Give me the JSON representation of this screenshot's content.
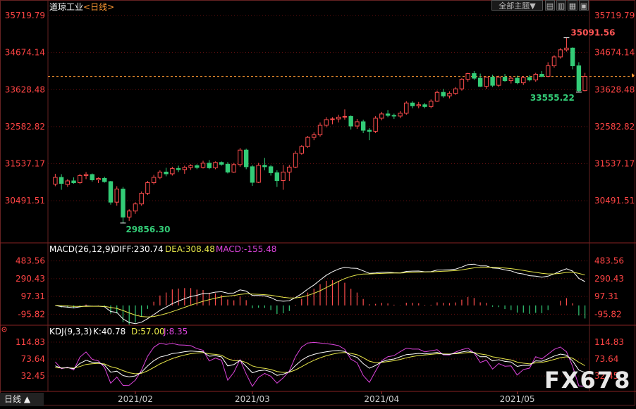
{
  "header": {
    "symbol": "道琼工业",
    "period": "<日线>",
    "theme_button": "全部主题▼",
    "period_tab": "日线 ▲"
  },
  "watermark": "FX678",
  "colors": {
    "up": "#ff4d4d",
    "down": "#33cc77",
    "axis_text": "#ff4444",
    "grid": "#661111",
    "price_line": "#ff9933",
    "diff": "#ffffff",
    "dea": "#e8e84a",
    "macd": "#dd44dd",
    "k": "#ffffff",
    "d": "#e8e84a",
    "j": "#dd44dd"
  },
  "chart_data": [
    {
      "type": "candlestick",
      "title": "道琼工业<日线>",
      "ylim": [
        29400,
        35800
      ],
      "y_ticks": [
        "35719.79",
        "34674.14",
        "33628.48",
        "32582.82",
        "31537.17",
        "30491.51"
      ],
      "x_ticks": [
        "2021/02",
        "2021/03",
        "2021/04",
        "2021/05"
      ],
      "annotations": {
        "high": "35091.56",
        "low": "29856.30",
        "recent_low": "33555.22"
      },
      "current_price": 34000,
      "ohlc": [
        [
          30960,
          31250,
          30900,
          31150
        ],
        [
          31150,
          31240,
          30800,
          30980
        ],
        [
          30950,
          31100,
          30880,
          31050
        ],
        [
          31050,
          31150,
          30970,
          31000
        ],
        [
          31000,
          31250,
          30960,
          31200
        ],
        [
          31200,
          31300,
          31100,
          31230
        ],
        [
          31230,
          31260,
          31030,
          31080
        ],
        [
          31080,
          31150,
          30990,
          31120
        ],
        [
          31120,
          31170,
          31000,
          31030
        ],
        [
          31030,
          31050,
          30380,
          30450
        ],
        [
          30450,
          30900,
          30350,
          30820
        ],
        [
          30820,
          30880,
          29860,
          30030
        ],
        [
          30030,
          30250,
          29920,
          30200
        ],
        [
          30200,
          30450,
          30120,
          30400
        ],
        [
          30400,
          30750,
          30350,
          30700
        ],
        [
          30700,
          31050,
          30650,
          31000
        ],
        [
          31000,
          31220,
          30950,
          31150
        ],
        [
          31150,
          31350,
          31100,
          31300
        ],
        [
          31300,
          31420,
          31180,
          31250
        ],
        [
          31250,
          31450,
          31200,
          31400
        ],
        [
          31400,
          31480,
          31300,
          31370
        ],
        [
          31370,
          31480,
          31250,
          31430
        ],
        [
          31430,
          31520,
          31360,
          31480
        ],
        [
          31480,
          31520,
          31380,
          31430
        ],
        [
          31430,
          31620,
          31400,
          31550
        ],
        [
          31550,
          31640,
          31380,
          31420
        ],
        [
          31420,
          31600,
          31380,
          31570
        ],
        [
          31570,
          31600,
          31480,
          31520
        ],
        [
          31520,
          31580,
          31260,
          31300
        ],
        [
          31300,
          31560,
          31280,
          31510
        ],
        [
          31510,
          31980,
          31450,
          31920
        ],
        [
          31920,
          31960,
          31380,
          31450
        ],
        [
          31450,
          31500,
          30910,
          31010
        ],
        [
          31010,
          31560,
          30990,
          31490
        ],
        [
          31490,
          31700,
          31350,
          31450
        ],
        [
          31450,
          31500,
          31200,
          31280
        ],
        [
          31280,
          31350,
          30880,
          31060
        ],
        [
          31060,
          31500,
          30800,
          31300
        ],
        [
          31300,
          31500,
          31050,
          31440
        ],
        [
          31440,
          31900,
          31410,
          31830
        ],
        [
          31830,
          32060,
          31790,
          32020
        ],
        [
          32020,
          32320,
          31980,
          32280
        ],
        [
          32280,
          32420,
          32200,
          32350
        ],
        [
          32350,
          32700,
          32300,
          32620
        ],
        [
          32620,
          32850,
          32560,
          32780
        ],
        [
          32780,
          32850,
          32650,
          32800
        ],
        [
          32800,
          32920,
          32700,
          32850
        ],
        [
          32850,
          33070,
          32780,
          32870
        ],
        [
          32870,
          32900,
          32500,
          32600
        ],
        [
          32600,
          32800,
          32520,
          32720
        ],
        [
          32720,
          32780,
          32400,
          32480
        ],
        [
          32480,
          32540,
          32200,
          32450
        ],
        [
          32450,
          32880,
          32400,
          32820
        ],
        [
          32820,
          33000,
          32760,
          32940
        ],
        [
          32940,
          33050,
          32850,
          32900
        ],
        [
          32900,
          32950,
          32800,
          32880
        ],
        [
          32880,
          33020,
          32820,
          32960
        ],
        [
          32960,
          33300,
          32920,
          33250
        ],
        [
          33250,
          33300,
          33100,
          33170
        ],
        [
          33170,
          33280,
          33100,
          33200
        ],
        [
          33200,
          33250,
          33100,
          33150
        ],
        [
          33150,
          33350,
          33100,
          33300
        ],
        [
          33300,
          33600,
          33280,
          33550
        ],
        [
          33550,
          33650,
          33400,
          33450
        ],
        [
          33450,
          33580,
          33380,
          33520
        ],
        [
          33520,
          33700,
          33480,
          33650
        ],
        [
          33650,
          33950,
          33600,
          33920
        ],
        [
          33920,
          34100,
          33850,
          34080
        ],
        [
          34080,
          34150,
          33900,
          33950
        ],
        [
          33950,
          34080,
          33700,
          33720
        ],
        [
          33720,
          34000,
          33650,
          33980
        ],
        [
          33980,
          34050,
          33700,
          33750
        ],
        [
          33750,
          34020,
          33700,
          33980
        ],
        [
          33980,
          34070,
          33850,
          33880
        ],
        [
          33880,
          34000,
          33800,
          33950
        ],
        [
          33950,
          34020,
          33780,
          33820
        ],
        [
          33820,
          34010,
          33760,
          33970
        ],
        [
          33970,
          34030,
          33860,
          33900
        ],
        [
          33900,
          34100,
          33850,
          34060
        ],
        [
          34060,
          34150,
          33980,
          34000
        ],
        [
          34000,
          34400,
          33980,
          34300
        ],
        [
          34300,
          34600,
          34250,
          34550
        ],
        [
          34550,
          34800,
          34500,
          34750
        ],
        [
          34750,
          35092,
          34700,
          34800
        ],
        [
          34800,
          34820,
          34200,
          34300
        ],
        [
          34300,
          34400,
          33556,
          33600
        ],
        [
          33600,
          34100,
          33580,
          34000
        ]
      ]
    },
    {
      "type": "bar",
      "title": "MACD(26,12,9)",
      "legend": {
        "diff": "DIFF:230.74",
        "dea": "DEA:308.48",
        "macd": "MACD:-155.48"
      },
      "y_ticks": [
        "483.56",
        "290.43",
        "97.31",
        "-95.82"
      ],
      "ylim": [
        -200,
        550
      ]
    },
    {
      "type": "line",
      "title": "KDJ(9,3,3)",
      "legend": {
        "k": "K:40.78",
        "d": "D:57.00",
        "j": "J:8.35"
      },
      "y_ticks": [
        "114.83",
        "73.64",
        "32.45"
      ],
      "ylim": [
        -5,
        125
      ]
    }
  ]
}
